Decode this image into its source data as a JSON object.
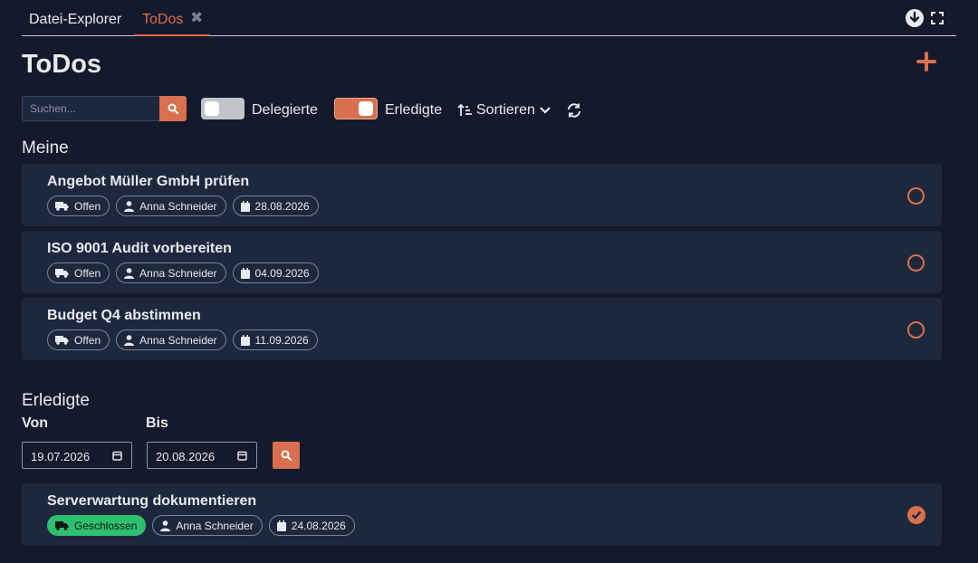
{
  "tabs": [
    {
      "label": "Datei-Explorer",
      "active": false
    },
    {
      "label": "ToDos",
      "active": true
    }
  ],
  "page": {
    "title": "ToDos"
  },
  "toolbar": {
    "search_placeholder": "Suchen...",
    "search_value": "",
    "delegated_label": "Delegierte",
    "delegated_on": false,
    "completed_label": "Erledigte",
    "completed_on": true,
    "sort_label": "Sortieren"
  },
  "sections": {
    "mine": {
      "title": "Meine",
      "items": [
        {
          "title": "Angebot Müller GmbH prüfen",
          "status": "Offen",
          "assignee": "Anna Schneider",
          "date": "28.08.2026"
        },
        {
          "title": "ISO 9001 Audit vorbereiten",
          "status": "Offen",
          "assignee": "Anna Schneider",
          "date": "04.09.2026"
        },
        {
          "title": "Budget Q4 abstimmen",
          "status": "Offen",
          "assignee": "Anna Schneider",
          "date": "11.09.2026"
        }
      ]
    },
    "completed": {
      "title": "Erledigte",
      "from_label": "Von",
      "to_label": "Bis",
      "from_value": "19.07.2026",
      "to_value": "20.08.2026",
      "items": [
        {
          "title": "Serverwartung dokumentieren",
          "status": "Geschlossen",
          "assignee": "Anna Schneider",
          "date": "24.08.2026"
        }
      ]
    }
  },
  "colors": {
    "accent": "#d96f4f",
    "closed": "#2fbf71",
    "background": "#141a2b",
    "card": "#1e283d"
  },
  "icons": [
    "close-icon",
    "download-icon",
    "fullscreen-icon",
    "plus-icon",
    "search-icon",
    "sort-icon",
    "chevron-down-icon",
    "refresh-icon",
    "truck-icon",
    "user-icon",
    "calendar-icon",
    "circle-icon",
    "check-circle-icon"
  ]
}
